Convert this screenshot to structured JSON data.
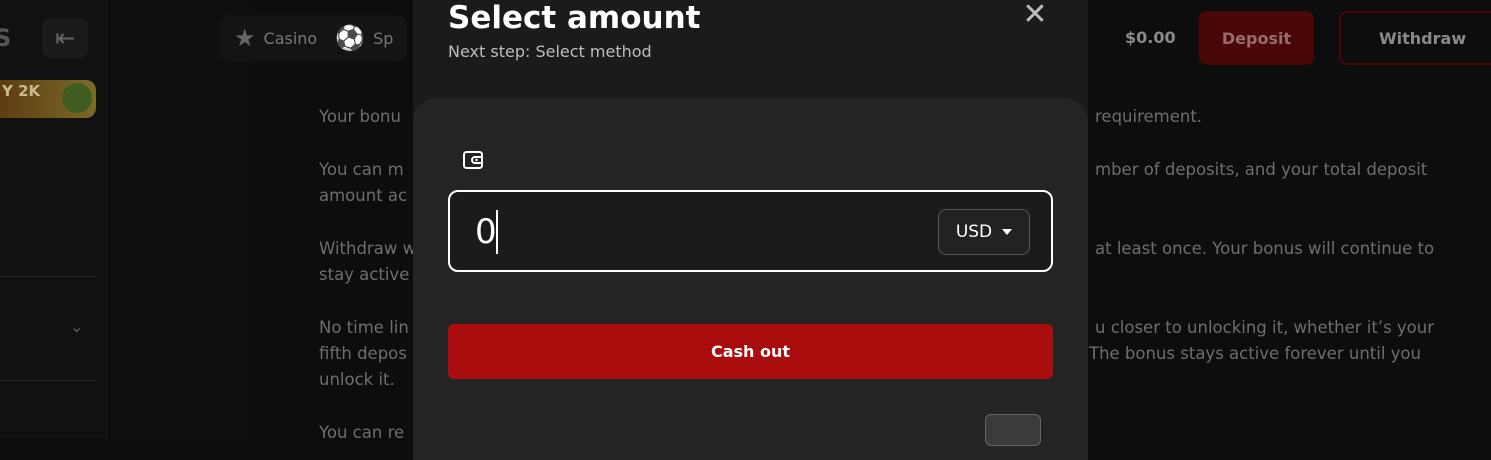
{
  "background": {
    "nav": [
      {
        "icon": "star-icon",
        "label": "Casino"
      },
      {
        "icon": "soccer-ball-icon",
        "label": "Sp"
      }
    ],
    "promo_text": "Y 2K",
    "balance": "$0.00",
    "deposit_label": "Deposit",
    "withdraw_label": "Withdraw",
    "article": [
      {
        "left": "Your bonu",
        "right": "requirement."
      },
      {
        "left": "You can m",
        "right": "mber of deposits, and your total deposit"
      },
      {
        "left": "amount ac",
        "right": ""
      },
      {
        "left": "Withdraw w",
        "right": "at least once. Your bonus will continue to"
      },
      {
        "left": "stay active",
        "right": ""
      },
      {
        "left": "No time lin",
        "right": "u closer to unlocking it, whether it’s your"
      },
      {
        "left": "fifth depos",
        "right": "The bonus stays active forever until you"
      },
      {
        "left": "unlock it.",
        "right": ""
      },
      {
        "left": "You can re",
        "right": ""
      }
    ]
  },
  "modal": {
    "title": "Select amount",
    "subtitle": "Next step: Select method",
    "amount_value": "0",
    "currency": "USD",
    "cashout_label": "Cash out"
  },
  "colors": {
    "accent": "#a90d0d",
    "modal_bg": "#1b1b1b",
    "panel_bg": "#242424"
  }
}
